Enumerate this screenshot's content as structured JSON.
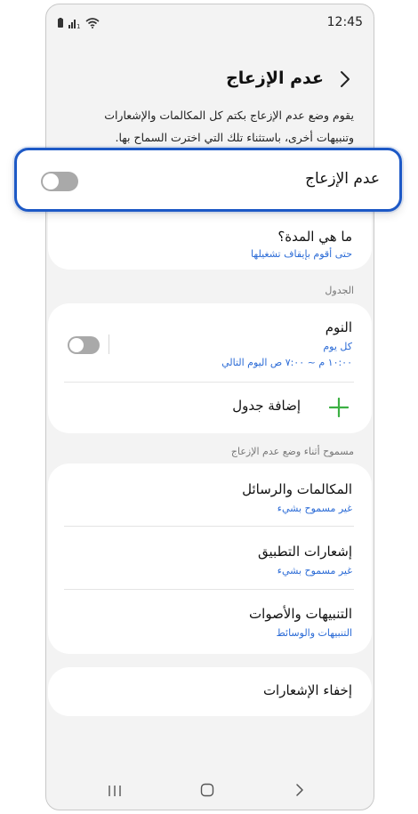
{
  "status_bar": {
    "time": "12:45",
    "icons": [
      "battery-icon",
      "signal-icon",
      "wifi-icon"
    ]
  },
  "header": {
    "title": "عدم الإزعاج",
    "back_icon": "chevron-back-icon"
  },
  "description": "يقوم وضع عدم الإزعاج بكتم كل المكالمات والإشعارات وتنبيهات أخرى، باستثناء تلك التي اخترت السماح بها.",
  "main_toggle": {
    "label": "عدم الإزعاج",
    "enabled": false
  },
  "duration": {
    "title": "ما هي المدة؟",
    "value": "حتى أقوم بإيقاف تشغيلها"
  },
  "schedule": {
    "section_label": "الجدول",
    "sleep": {
      "title": "النوم",
      "days": "كل يوم",
      "time": "١٠:٠٠ م ~ ٧:٠٠ ص اليوم التالي",
      "enabled": false
    },
    "add_label": "إضافة جدول"
  },
  "allowed": {
    "section_label": "مسموح أثناء وضع عدم الإزعاج",
    "items": [
      {
        "title": "المكالمات والرسائل",
        "value": "غير مسموح بشيء"
      },
      {
        "title": "إشعارات التطبيق",
        "value": "غير مسموح بشيء"
      },
      {
        "title": "التنبيهات والأصوات",
        "value": "التنبيهات والوسائط"
      }
    ]
  },
  "hide_notifications": {
    "title": "إخفاء الإشعارات"
  },
  "nav_bar": {
    "items": [
      "recents-icon",
      "home-icon",
      "back-icon"
    ]
  },
  "colors": {
    "accent_blue": "#2b6bd6",
    "highlight_border": "#1d59c6",
    "add_plus": "#3cb043"
  }
}
